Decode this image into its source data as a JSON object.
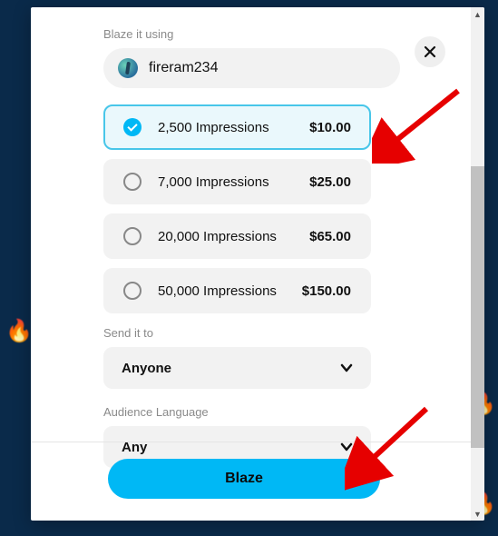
{
  "section_labels": {
    "blaze_using": "Blaze it using",
    "send_to": "Send it to",
    "audience_lang": "Audience Language"
  },
  "user": {
    "name": "fireram234"
  },
  "tiers": [
    {
      "label": "2,500 Impressions",
      "price": "$10.00",
      "selected": true
    },
    {
      "label": "7,000 Impressions",
      "price": "$25.00",
      "selected": false
    },
    {
      "label": "20,000 Impressions",
      "price": "$65.00",
      "selected": false
    },
    {
      "label": "50,000 Impressions",
      "price": "$150.00",
      "selected": false
    }
  ],
  "dropdowns": {
    "send_to_value": "Anyone",
    "audience_lang_value": "Any"
  },
  "cta": {
    "blaze": "Blaze"
  }
}
